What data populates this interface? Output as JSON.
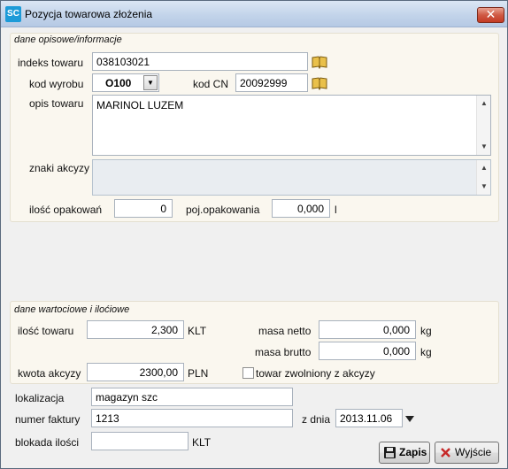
{
  "window": {
    "app_icon_text": "SC",
    "title": "Pozycja towarowa złożenia",
    "close_label": "✕"
  },
  "section_desc": {
    "title": "dane opisowe/informacje",
    "indeks_label": "indeks towaru",
    "indeks_value": "038103021",
    "kod_wyrobu_label": "kod wyrobu",
    "kod_wyrobu_value": "O100",
    "kod_cn_label": "kod CN",
    "kod_cn_value": "20092999",
    "opis_label": "opis towaru",
    "opis_value": "MARINOL LUZEM",
    "znaki_label": "znaki akcyzy",
    "znaki_value": "",
    "ilosc_opak_label": "ilość opakowań",
    "ilosc_opak_value": "0",
    "poj_label": "poj.opakowania",
    "poj_value": "0,000",
    "poj_unit": "l"
  },
  "section_values": {
    "title": "dane wartociowe i iloćiowe",
    "ilosc_towaru_label": "ilość towaru",
    "ilosc_towaru_value": "2,300",
    "ilosc_unit": "KLT",
    "masa_netto_label": "masa netto",
    "masa_netto_value": "0,000",
    "masa_netto_unit": "kg",
    "masa_brutto_label": "masa brutto",
    "masa_brutto_value": "0,000",
    "masa_brutto_unit": "kg",
    "kwota_label": "kwota akcyzy",
    "kwota_value": "2300,00",
    "kwota_unit": "PLN",
    "zwolniony_label": "towar zwolniony z akcyzy"
  },
  "bottom": {
    "lokalizacja_label": "lokalizacja",
    "lokalizacja_value": "magazyn szc",
    "faktura_label": "numer faktury",
    "faktura_value": "1213",
    "zdnia_label": "z dnia",
    "zdnia_value": "2013.11.06",
    "blokada_label": "blokada ilości",
    "blokada_value": "",
    "blokada_unit": "KLT"
  },
  "buttons": {
    "save": "Zapis",
    "exit": "Wyjście"
  },
  "colors": {
    "group_bg": "#faf7ef",
    "window_bg": "#f0f0f0",
    "close_red": "#c43b24"
  }
}
